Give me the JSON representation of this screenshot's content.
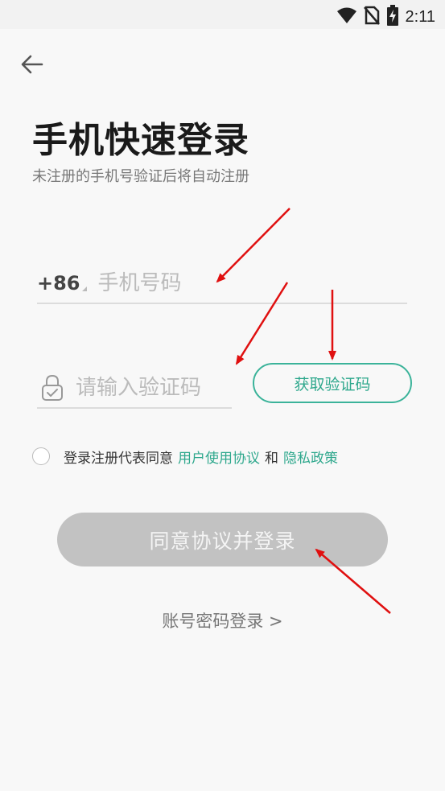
{
  "status_bar": {
    "time": "2:11",
    "icons": [
      "wifi-icon",
      "no-sim-icon",
      "battery-charging-icon"
    ]
  },
  "header": {
    "back_icon": "arrow-left-icon",
    "title": "手机快速登录",
    "subtitle": "未注册的手机号验证后将自动注册"
  },
  "phone_field": {
    "country_code": "+86",
    "placeholder": "手机号码",
    "value": ""
  },
  "code_field": {
    "icon": "lock-icon",
    "placeholder": "请输入验证码",
    "value": ""
  },
  "get_code_button": {
    "label": "获取验证码"
  },
  "agreement": {
    "checked": false,
    "prefix": "登录注册代表同意",
    "terms_link": "用户使用协议",
    "and": "和",
    "privacy_link": "隐私政策"
  },
  "login_button": {
    "label": "同意协议并登录",
    "enabled": false
  },
  "account_login_link": {
    "label": "账号密码登录 >"
  },
  "colors": {
    "accent": "#2fa88d",
    "button_disabled": "#c2c2c2",
    "annotation_arrow": "#e01010"
  }
}
